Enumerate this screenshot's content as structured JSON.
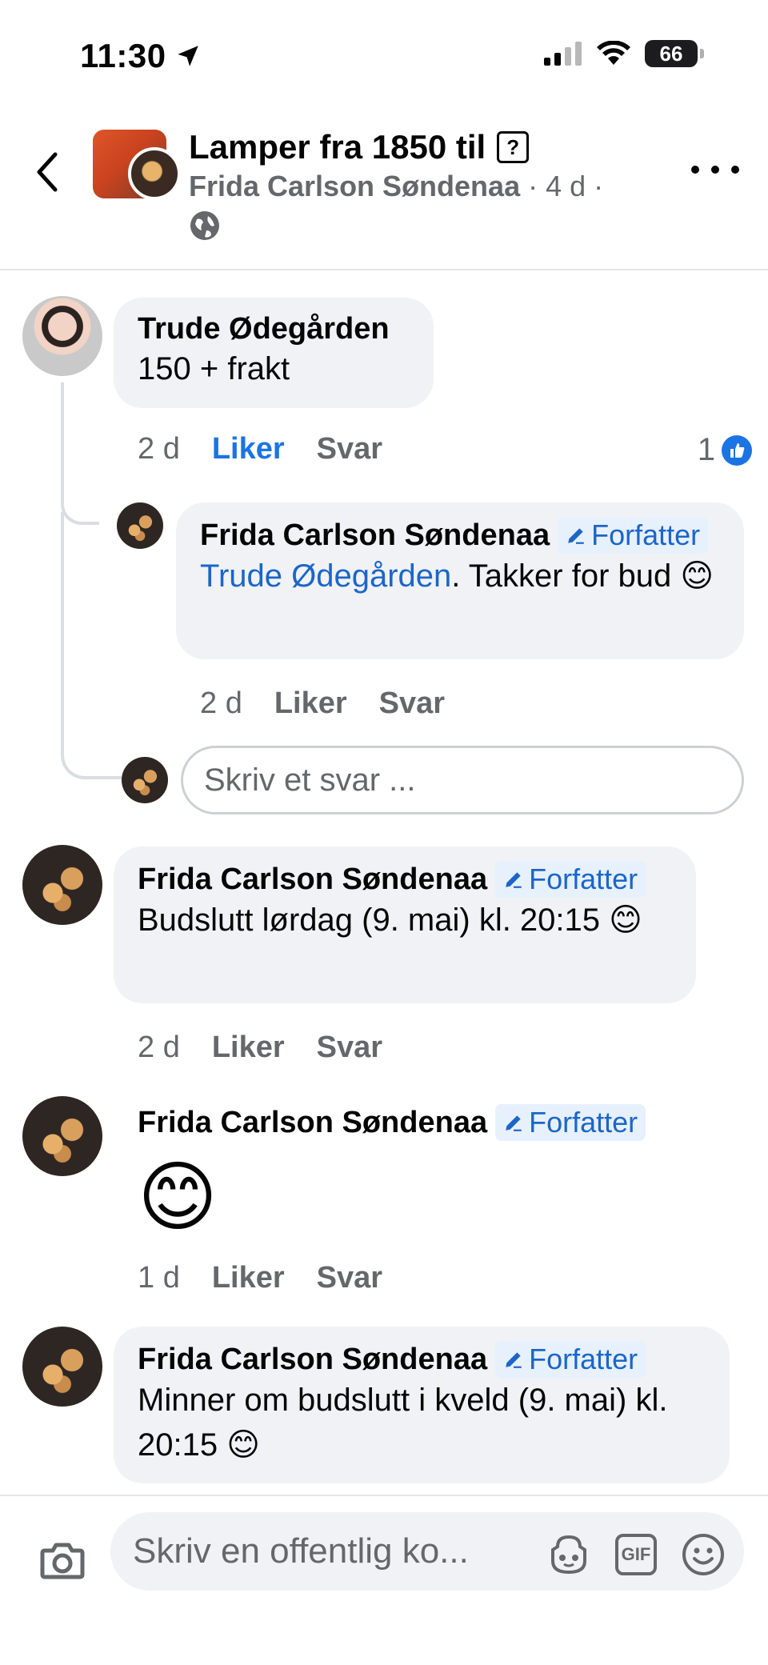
{
  "status_bar": {
    "time": "11:30",
    "battery": "66"
  },
  "header": {
    "title": "Lamper fra 1850 til",
    "author": "Frida Carlson Søndenaa",
    "meta": " · 4 d ·"
  },
  "comments": [
    {
      "name": "Trude Ødegården",
      "text": "150 + frakt",
      "time": "2 d",
      "like_label": "Liker",
      "reply_label": "Svar",
      "reaction_count": "1",
      "replies": [
        {
          "name": "Frida Carlson Søndenaa",
          "badge": "Forfatter",
          "mention": "Trude Ødegården",
          "text": ". Takker for bud 😊",
          "time": "2 d",
          "like_label": "Liker",
          "reply_label": "Svar"
        }
      ],
      "reply_placeholder": "Skriv et svar ..."
    },
    {
      "name": "Frida Carlson Søndenaa",
      "badge": "Forfatter",
      "text": "Budslutt lørdag (9. mai) kl. 20:15 😊",
      "time": "2 d",
      "like_label": "Liker",
      "reply_label": "Svar"
    },
    {
      "name": "Frida Carlson Søndenaa",
      "badge": "Forfatter",
      "text": "😊",
      "time": "1 d",
      "like_label": "Liker",
      "reply_label": "Svar"
    },
    {
      "name": "Frida Carlson Søndenaa",
      "badge": "Forfatter",
      "text": "Minner om budslutt i kveld (9. mai) kl. 20:15 😊"
    }
  ],
  "composer": {
    "placeholder": "Skriv en offentlig ko...",
    "gif_label": "GIF"
  },
  "colors": {
    "link_blue": "#1b74e4",
    "bubble_bg": "#f0f2f5",
    "secondary_text": "#65676b"
  }
}
